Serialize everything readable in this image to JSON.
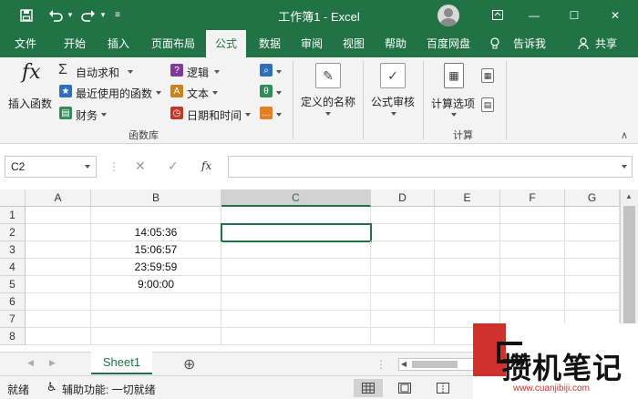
{
  "titlebar": {
    "title": "工作簿1  -  Excel",
    "save_icon": "save-icon",
    "undo_icon": "undo-icon",
    "redo_icon": "redo-icon",
    "minimize": "—",
    "restore": "☐",
    "close": "✕"
  },
  "tabs": [
    "文件",
    "开始",
    "插入",
    "页面布局",
    "公式",
    "数据",
    "审阅",
    "视图",
    "帮助",
    "百度网盘",
    "告诉我",
    "共享"
  ],
  "ribbon": {
    "insert_function": "插入函数",
    "autosum": "自动求和",
    "recent": "最近使用的函数",
    "financial": "财务",
    "logical": "逻辑",
    "text": "文本",
    "datetime": "日期和时间",
    "group_function_library": "函数库",
    "defined_names": "定义的名称",
    "formula_auditing": "公式审核",
    "calc_options": "计算选项",
    "group_calculation": "计算",
    "fx_symbol": "fx"
  },
  "formula_bar": {
    "name_box": "C2",
    "fx": "fx",
    "value": ""
  },
  "grid": {
    "columns": [
      "A",
      "B",
      "C",
      "D",
      "E",
      "F",
      "G"
    ],
    "rows": [
      "1",
      "2",
      "3",
      "4",
      "5",
      "6",
      "7",
      "8"
    ],
    "b_values": [
      "",
      "14:05:36",
      "15:06:57",
      "23:59:59",
      "9:00:00",
      "",
      "",
      ""
    ]
  },
  "sheet": {
    "tab": "Sheet1",
    "add": "⊕"
  },
  "status": {
    "ready": "就绪",
    "accessibility": "辅助功能: 一切就绪"
  },
  "watermark": {
    "text": "攒机笔记",
    "url": "www.cuanjibiji.com"
  },
  "colors": {
    "accent": "#217346",
    "ribbon": "#f3f3f3"
  }
}
